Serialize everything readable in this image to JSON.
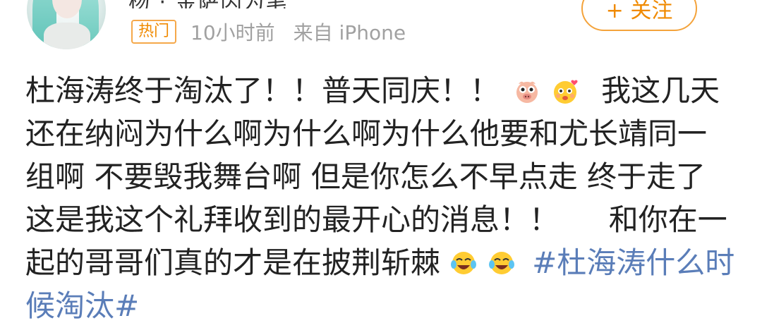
{
  "header": {
    "name_fragment": "杨 · 金萨因为笔",
    "follow_label": "+ 关注",
    "badge": "热门",
    "time": "10小时前",
    "source": "来自 iPhone"
  },
  "post": {
    "line1": "杜海涛终于淘汰了！！普天同庆！！",
    "line1_b": "我这几天",
    "line2": "还在纳闷为什么啊为什么啊为什么他要和尤长靖同一",
    "line3": "组啊 不要毁我舞台啊 但是你怎么不早点走 终于走了",
    "line4": "这是我这个礼拜收到的最开心的消息！！",
    "line4_b": "和你在一",
    "line5": "起的哥哥们真的才是在披荆斩棘",
    "topic_part1": "#杜海涛什么时",
    "topic_part2": "候淘汰#"
  },
  "icons": [
    "pig-face-emoji-icon",
    "hearts-face-emoji-icon",
    "laugh-cry-emoji-icon",
    "laugh-cry-emoji-icon"
  ],
  "colors": {
    "accent_orange": "#f08a00",
    "topic_blue": "#5a7db8",
    "meta_gray": "#a1a1a1"
  }
}
